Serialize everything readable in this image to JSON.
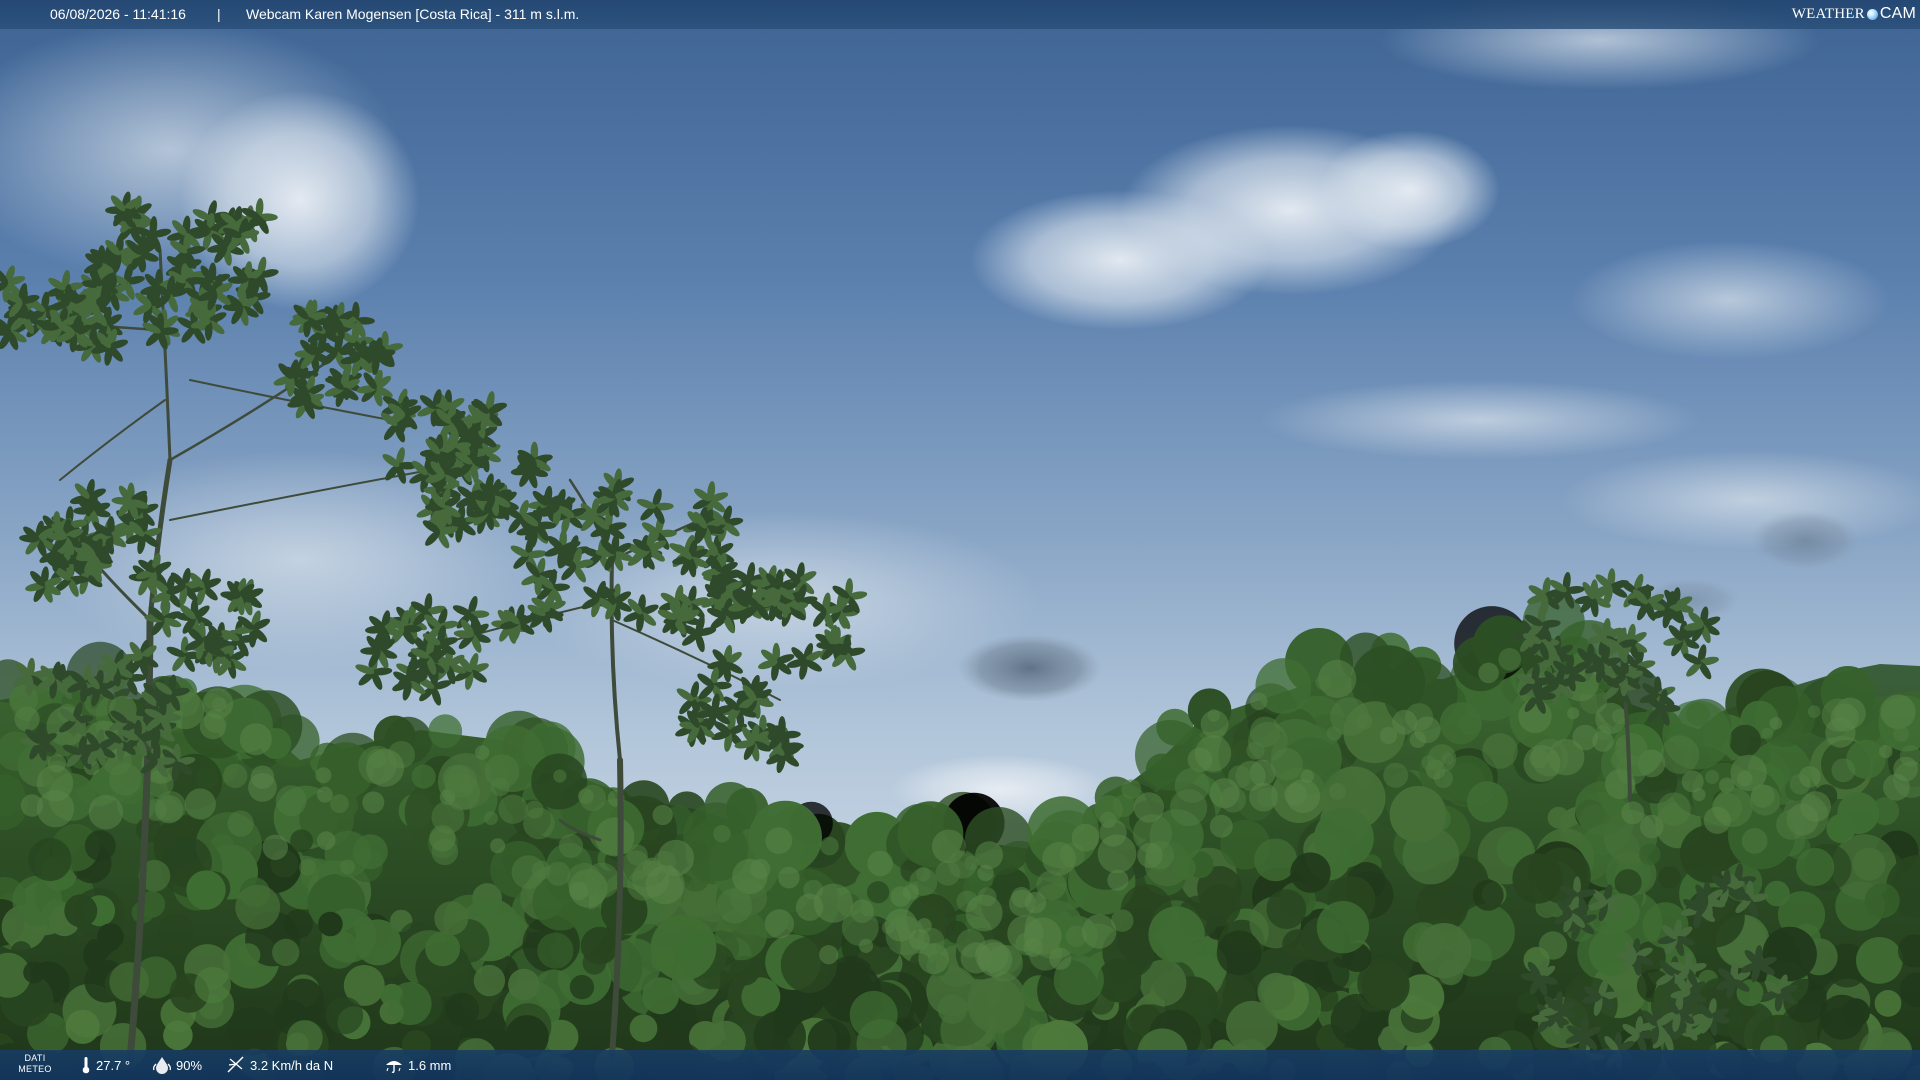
{
  "overlay": {
    "datetime": "06/08/2026 - 11:41:16",
    "separator": "|",
    "title": "Webcam Karen Mogensen [Costa Rica]  - 311 m s.l.m."
  },
  "logo": {
    "word": "WEATHER",
    "cam": "CAM"
  },
  "weather_bar": {
    "label_line1": "DATI",
    "label_line2": "METEO",
    "temperature": "27.7 °",
    "humidity": "90%",
    "wind": "3.2 Km/h da N",
    "rain": "1.6 mm"
  },
  "colors": {
    "bar": "#1f4a7a",
    "sky_top": "#3e6494",
    "sky_bottom": "#c2d3e0",
    "forest": "#2c4a22"
  },
  "icons": {
    "temperature": "thermometer-icon",
    "humidity": "humidity-drop-icon",
    "wind": "wind-icon",
    "rain": "rain-icon"
  }
}
